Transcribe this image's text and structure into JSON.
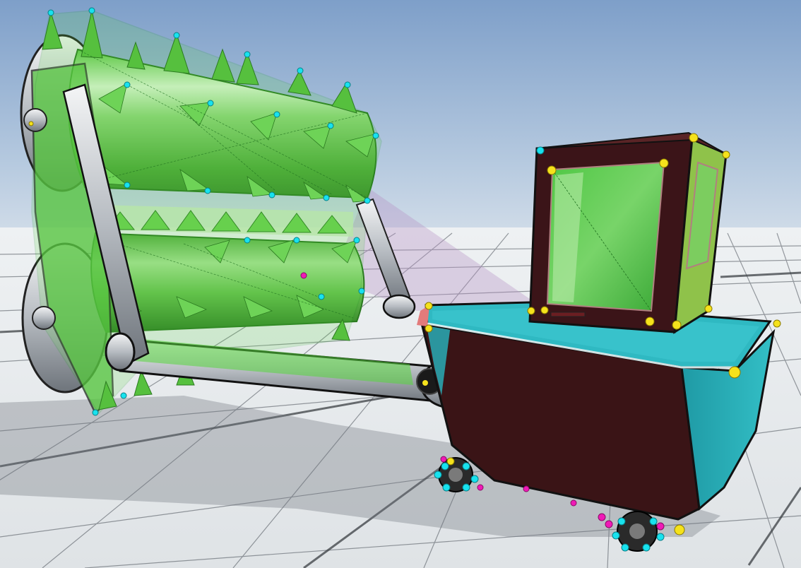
{
  "scene": {
    "colors": {
      "sky_top": "#7e9fc9",
      "sky_horizon": "#c9d8e8",
      "floor": "#e4e7ea",
      "grid_line": "#3c4248",
      "selection_green": "#3fcf2f",
      "hull_maroon": "#3a1416",
      "hull_teal": "#27a9b3",
      "steel": "#c9cdd2",
      "handle_yellow": "#f5e21c",
      "handle_cyan": "#18e2ee",
      "handle_magenta": "#ef1ab6"
    },
    "objects": [
      "spiked-drum-roller",
      "steel-arm-linkage",
      "hull-body",
      "cabin",
      "tracked-wheels"
    ]
  }
}
